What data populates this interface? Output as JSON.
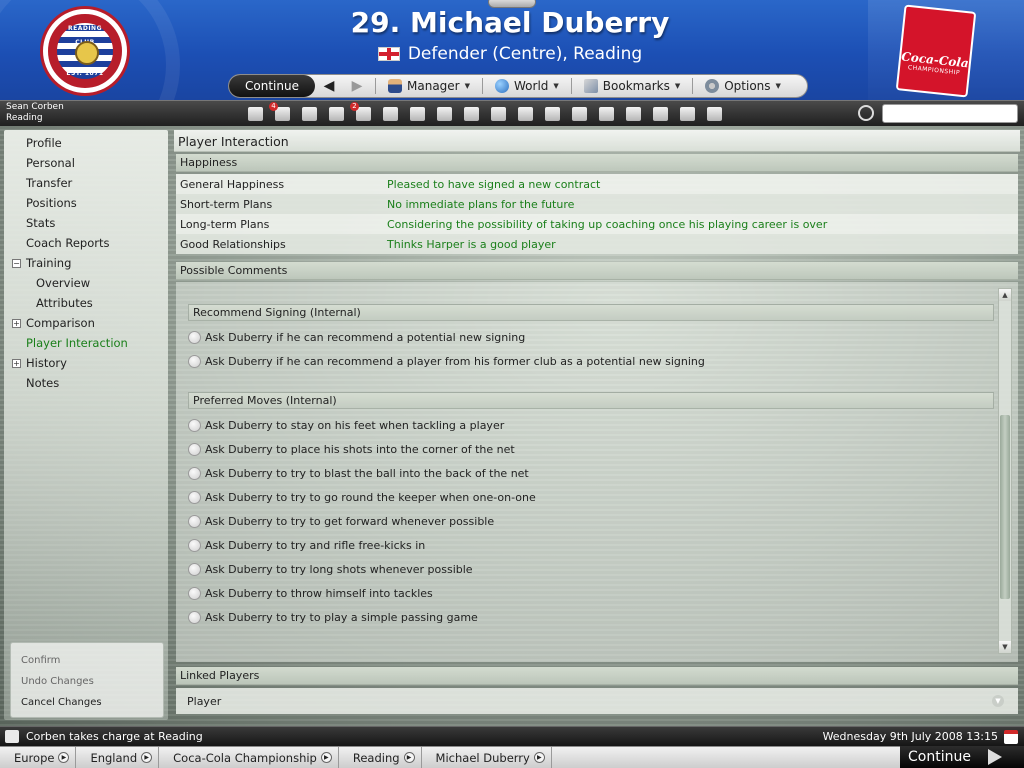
{
  "header": {
    "player_name": "29. Michael Duberry",
    "position_club": "Defender (Centre), Reading",
    "crest_top": "READING FOOTBALL CLUB",
    "crest_bottom": "EST. 1871",
    "sponsor_brand": "Coca-Cola",
    "sponsor_sub": "CHAMPIONSHIP"
  },
  "toolbar": {
    "continue_label": "Continue",
    "back_icon": "back-arrow-icon",
    "forward_icon": "forward-arrow-icon",
    "manager_label": "Manager",
    "world_label": "World",
    "bookmarks_label": "Bookmarks",
    "options_label": "Options"
  },
  "manager_bar": {
    "manager_name": "Sean Corben",
    "club": "Reading",
    "icons": [
      {
        "name": "home-icon",
        "badge": ""
      },
      {
        "name": "inbox-icon",
        "badge": "4"
      },
      {
        "name": "notebook-icon",
        "badge": ""
      },
      {
        "name": "calendar-icon",
        "badge": ""
      },
      {
        "name": "clock-icon",
        "badge": "2"
      },
      {
        "name": "squad-icon",
        "badge": ""
      },
      {
        "name": "transfers-icon",
        "badge": ""
      },
      {
        "name": "tactics-icon",
        "badge": ""
      },
      {
        "name": "trophy-icon",
        "badge": ""
      },
      {
        "name": "scouting-icon",
        "badge": ""
      },
      {
        "name": "clipboard-icon",
        "badge": ""
      },
      {
        "name": "training-icon",
        "badge": ""
      },
      {
        "name": "ball-icon",
        "badge": ""
      },
      {
        "name": "binoculars-icon",
        "badge": ""
      },
      {
        "name": "finances-icon",
        "badge": ""
      },
      {
        "name": "chat-icon",
        "badge": ""
      },
      {
        "name": "help-icon",
        "badge": ""
      },
      {
        "name": "question-icon",
        "badge": ""
      }
    ]
  },
  "sidebar": {
    "items": [
      {
        "label": "Profile"
      },
      {
        "label": "Personal"
      },
      {
        "label": "Transfer"
      },
      {
        "label": "Positions"
      },
      {
        "label": "Stats"
      },
      {
        "label": "Coach Reports"
      },
      {
        "label": "Training"
      },
      {
        "label": "Overview"
      },
      {
        "label": "Attributes"
      },
      {
        "label": "Comparison"
      },
      {
        "label": "Player Interaction"
      },
      {
        "label": "History"
      },
      {
        "label": "Notes"
      }
    ],
    "actions": {
      "confirm": "Confirm",
      "undo": "Undo Changes",
      "cancel": "Cancel Changes"
    }
  },
  "main": {
    "title": "Player Interaction",
    "happiness": {
      "header": "Happiness",
      "rows": [
        {
          "label": "General Happiness",
          "value": "Pleased to have signed a new contract"
        },
        {
          "label": "Short-term Plans",
          "value": "No immediate plans for the future"
        },
        {
          "label": "Long-term Plans",
          "value": "Considering the possibility of taking up coaching once his playing career is over"
        },
        {
          "label": "Good Relationships",
          "value": "Thinks Harper is a good player"
        }
      ]
    },
    "comments": {
      "header": "Possible Comments",
      "groups": [
        {
          "title": "Recommend Signing (Internal)",
          "options": [
            "Ask Duberry if he can recommend a potential new signing",
            "Ask Duberry if he can recommend a player from his former club as a potential new signing"
          ]
        },
        {
          "title": "Preferred Moves (Internal)",
          "options": [
            "Ask Duberry to stay on his feet when tackling a player",
            "Ask Duberry to place his shots into the corner of the net",
            "Ask Duberry to try to blast the ball into the back of the net",
            "Ask Duberry to try to go round the keeper when one-on-one",
            "Ask Duberry to try to get forward whenever possible",
            "Ask Duberry to try and rifle free-kicks in",
            "Ask Duberry to try long shots whenever possible",
            "Ask Duberry to throw himself into tackles",
            "Ask Duberry to try to play a simple passing game"
          ]
        }
      ]
    },
    "linked_players": {
      "header": "Linked Players",
      "column": "Player"
    }
  },
  "status": {
    "news": "Corben takes charge at Reading",
    "date": "Wednesday 9th July 2008 13:15"
  },
  "breadcrumb": [
    "Europe",
    "England",
    "Coca-Cola Championship",
    "Reading",
    "Michael Duberry"
  ],
  "continue_label": "Continue",
  "colors": {
    "header_blue": "#1c4fb4",
    "positive_green": "#1a7f1a",
    "reading_red": "#b71d2a"
  }
}
